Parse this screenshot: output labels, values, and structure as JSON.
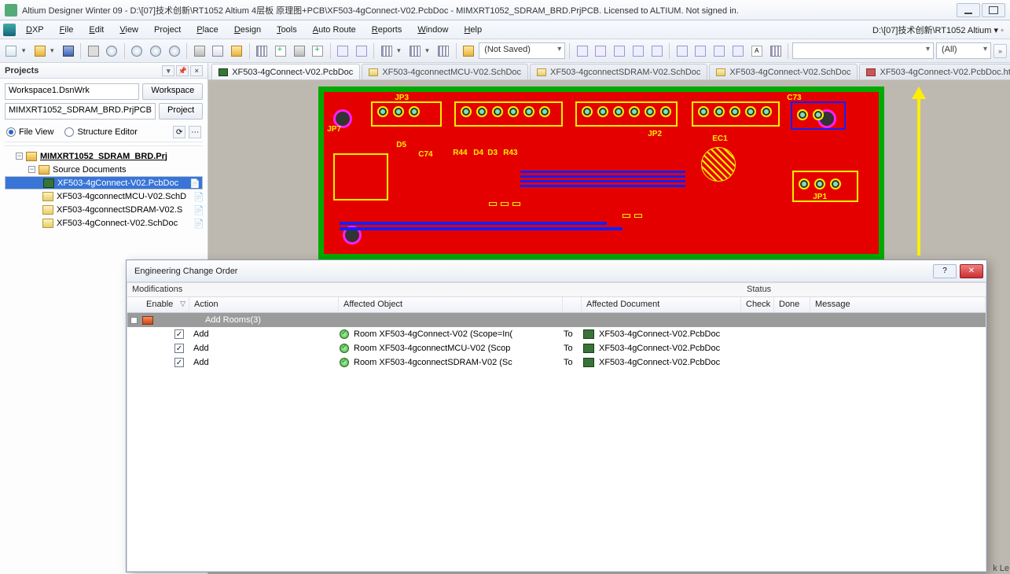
{
  "titlebar": "Altium Designer Winter 09 - D:\\[07]技术创新\\RT1052 Altium 4层板 原理图+PCB\\XF503-4gConnect-V02.PcbDoc - MIMXRT1052_SDRAM_BRD.PrjPCB. Licensed to ALTIUM. Not signed in.",
  "menubar": {
    "dxp": "DXP",
    "items": [
      "File",
      "Edit",
      "View",
      "Project",
      "Place",
      "Design",
      "Tools",
      "Auto Route",
      "Reports",
      "Window",
      "Help"
    ],
    "right_path": "D:\\[07]技术创新\\RT1052 Altium ▾ ◦"
  },
  "toolbar": {
    "ns_label": "(Not Saved)",
    "all_label": "(All)"
  },
  "projects_panel": {
    "title": "Projects",
    "workspace_value": "Workspace1.DsnWrk",
    "workspace_btn": "Workspace",
    "project_value": "MIMXRT1052_SDRAM_BRD.PrjPCB",
    "project_btn": "Project",
    "fileview_label": "File View",
    "structure_label": "Structure Editor",
    "tree": {
      "root": "MIMXRT1052_SDRAM_BRD.Prj",
      "src": "Source Documents",
      "docs": [
        "XF503-4gConnect-V02.PcbDoc",
        "XF503-4gconnectMCU-V02.SchD",
        "XF503-4gconnectSDRAM-V02.S",
        "XF503-4gConnect-V02.SchDoc"
      ]
    }
  },
  "tabs": [
    "XF503-4gConnect-V02.PcbDoc",
    "XF503-4gconnectMCU-V02.SchDoc",
    "XF503-4gconnectSDRAM-V02.SchDoc",
    "XF503-4gConnect-V02.SchDoc",
    "XF503-4gConnect-V02.PcbDoc.htm"
  ],
  "board_labels": {
    "jp3": "JP3",
    "c73": "C73",
    "jp7": "JP7",
    "d5": "D5",
    "c74": "C74",
    "r44": "R44",
    "d4": "D4",
    "d3": "D3",
    "r43": "R43",
    "jp2": "JP2",
    "ec1": "EC1",
    "jp1": "JP1"
  },
  "eco": {
    "title": "Engineering Change Order",
    "mods": "Modifications",
    "status": "Status",
    "cols": {
      "enable": "Enable",
      "action": "Action",
      "affobj": "Affected Object",
      "affdoc": "Affected Document",
      "check": "Check",
      "done": "Done",
      "msg": "Message"
    },
    "group": "Add Rooms(3)",
    "rows": [
      {
        "action": "Add",
        "obj": "Room XF503-4gConnect-V02 (Scope=In(",
        "to": "To",
        "doc": "XF503-4gConnect-V02.PcbDoc"
      },
      {
        "action": "Add",
        "obj": "Room XF503-4gconnectMCU-V02 (Scop",
        "to": "To",
        "doc": "XF503-4gConnect-V02.PcbDoc"
      },
      {
        "action": "Add",
        "obj": "Room XF503-4gconnectSDRAM-V02 (Sc",
        "to": "To",
        "doc": "XF503-4gConnect-V02.PcbDoc"
      }
    ]
  },
  "corner": "k Le"
}
